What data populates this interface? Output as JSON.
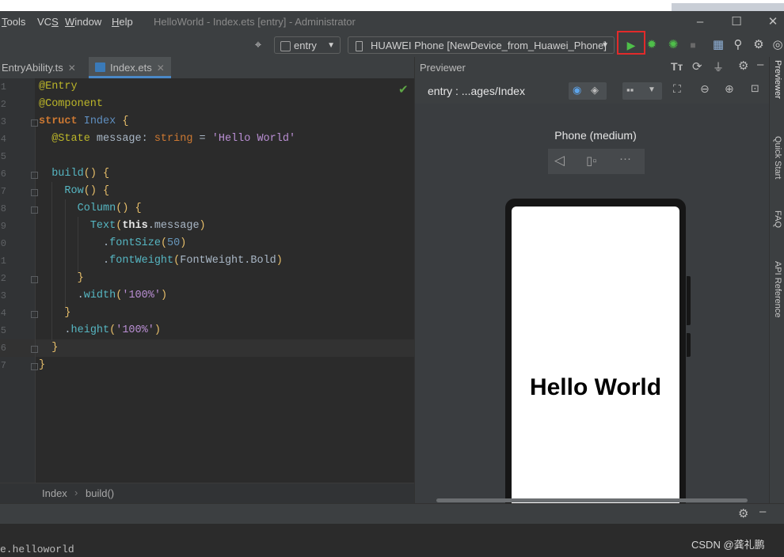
{
  "window": {
    "title": "HelloWorld - Index.ets [entry] - Administrator",
    "menu": [
      {
        "label": "Tools",
        "mnemonic": "T"
      },
      {
        "label": "VCS",
        "mnemonic": "S"
      },
      {
        "label": "Window",
        "mnemonic": "W"
      },
      {
        "label": "Help",
        "mnemonic": "H"
      }
    ]
  },
  "toolbar": {
    "module": "entry",
    "device": "HUAWEI Phone [NewDevice_from_Huawei_Phone]",
    "run_highlight_color": "#e22a2a",
    "run_icon": "play-icon",
    "debug_icon": "debug-icon"
  },
  "editor": {
    "tabs": [
      {
        "label": "EntryAbility.ts",
        "active": false
      },
      {
        "label": "Index.ets",
        "active": true
      }
    ],
    "line_numbers": [
      "1",
      "2",
      "3",
      "4",
      "5",
      "6",
      "7",
      "8",
      "9",
      "0",
      "1",
      "2",
      "3",
      "4",
      "5",
      "6",
      "7"
    ],
    "code_lines": [
      "@Entry",
      "@Component",
      "struct Index {",
      "  @State message: string = 'Hello World'",
      "",
      "  build() {",
      "    Row() {",
      "      Column() {",
      "        Text(this.message)",
      "          .fontSize(50)",
      "          .fontWeight(FontWeight.Bold)",
      "      }",
      "      .width('100%')",
      "    }",
      "    .height('100%')",
      "  }",
      "}"
    ],
    "breadcrumb": [
      "Index",
      "build()"
    ]
  },
  "previewer": {
    "title": "Previewer",
    "path": "entry : ...ages/Index",
    "device_label": "Phone (medium)",
    "screen_text": "Hello World"
  },
  "right_sidebar": [
    "Previewer",
    "Quick Start",
    "FAQ",
    "API Reference"
  ],
  "console": {
    "text": "e.helloworld"
  },
  "watermark": "CSDN @龚礼鹏"
}
